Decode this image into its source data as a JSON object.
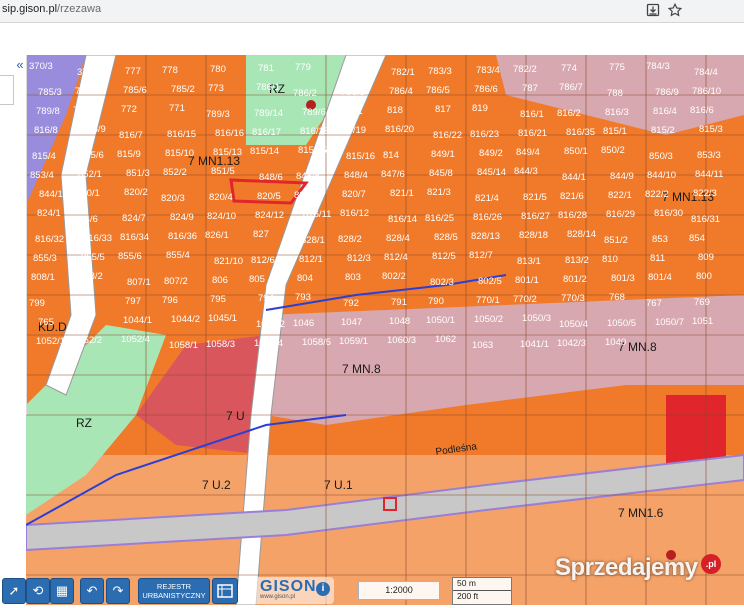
{
  "browser": {
    "url_host": "sip.gison.pl",
    "url_path": "/rzezawa",
    "icons": [
      "download-icon",
      "star-icon"
    ]
  },
  "side_panel": {
    "collapse_icon": "«"
  },
  "map": {
    "colors": {
      "residential_orange": "#f07a2a",
      "residential_light": "#f4a268",
      "mixed_pink": "#d8a8b0",
      "green_zone": "#a9e6b5",
      "purple_zone": "#9a8cdc",
      "red_zone": "#d9565c",
      "road_white": "#ffffff",
      "road_gray": "#c8c8c8",
      "parcel_line": "#8a4a2a",
      "plan_line_blue": "#2b3fd6"
    },
    "zone_labels": [
      "RZ",
      "7 MN1.13",
      "7 MN1.13",
      "7 MN.8",
      "7 MN.8",
      "7 U",
      "7 U.2",
      "7 U.1",
      "7 MN1.6",
      "RZ",
      "KD.D"
    ],
    "parcel_labels": [
      "370/3",
      "370/2",
      "777",
      "778",
      "780",
      "781",
      "779",
      "776",
      "782/1",
      "783/3",
      "783/4",
      "782/2",
      "774",
      "775",
      "784/3",
      "784/4",
      "785/3",
      "784/5",
      "785/6",
      "785/2",
      "773",
      "786/1",
      "786/2",
      "786/3",
      "786/4",
      "786/5",
      "786/6",
      "787",
      "786/7",
      "788",
      "786/9",
      "786/10",
      "789/8",
      "789/9",
      "772",
      "771",
      "789/3",
      "789/14",
      "789/6",
      "789/1",
      "818",
      "817",
      "819",
      "816/1",
      "816/2",
      "816/3",
      "816/4",
      "816/6",
      "816/8",
      "816/9",
      "816/7",
      "816/15",
      "816/16",
      "816/17",
      "816/18",
      "816/19",
      "816/20",
      "816/22",
      "816/23",
      "816/21",
      "816/35",
      "815/1",
      "815/2",
      "815/3",
      "815/4",
      "815/6",
      "815/9",
      "815/10",
      "815/13",
      "815/14",
      "815/15",
      "815/16",
      "814",
      "849/1",
      "849/2",
      "849/4",
      "850/1",
      "850/2",
      "850/3",
      "853/3",
      "853/4",
      "852/1",
      "851/3",
      "852/2",
      "851/5",
      "848/6",
      "848/8",
      "848/4",
      "847/6",
      "845/8",
      "845/14",
      "844/3",
      "844/1",
      "844/9",
      "844/10",
      "844/11",
      "844/12",
      "820/1",
      "820/2",
      "820/3",
      "820/4",
      "820/5",
      "820/6",
      "820/7",
      "821/1",
      "821/3",
      "821/4",
      "821/5",
      "821/6",
      "822/1",
      "822/2",
      "822/3",
      "824/1",
      "824/6",
      "824/7",
      "824/9",
      "824/10",
      "824/12",
      "816/11",
      "816/12",
      "816/14",
      "816/25",
      "816/26",
      "816/27",
      "816/28",
      "816/29",
      "816/30",
      "816/31",
      "816/32",
      "816/33",
      "816/34",
      "816/36",
      "826/1",
      "827",
      "828/1",
      "828/2",
      "828/4",
      "828/5",
      "828/13",
      "828/18",
      "828/14",
      "851/2",
      "853",
      "854",
      "855/3",
      "855/5",
      "855/6",
      "855/4",
      "821/10",
      "812/6",
      "812/1",
      "812/3",
      "812/4",
      "812/5",
      "812/7",
      "813/1",
      "813/2",
      "810",
      "811",
      "809",
      "808/1",
      "808/2",
      "807/1",
      "807/2",
      "806",
      "805",
      "804",
      "803",
      "802/2",
      "802/3",
      "802/5",
      "801/1",
      "801/2",
      "801/3",
      "801/4",
      "800",
      "799",
      "798",
      "797",
      "796",
      "795",
      "794",
      "793",
      "792",
      "791",
      "790",
      "770/1",
      "770/2",
      "770/3",
      "768",
      "767",
      "769",
      "765",
      "766",
      "1044/1",
      "1044/2",
      "1045/1",
      "1045/2",
      "1046",
      "1047",
      "1048",
      "1050/1",
      "1050/2",
      "1050/3",
      "1050/4",
      "1050/5",
      "1050/7",
      "1051",
      "1052/1",
      "1052/2",
      "1052/4",
      "1058/1",
      "1058/3",
      "1058/4",
      "1058/5",
      "1059/1",
      "1060/3",
      "1062",
      "1063",
      "1041/1",
      "1042/3",
      "1040"
    ],
    "street_label": "Podleśna"
  },
  "toolbar": {
    "tools": [
      "cursor-icon",
      "measure-icon",
      "map-icon",
      "undo-icon",
      "redo-icon"
    ],
    "register_line1": "REJESTR",
    "register_line2": "URBANISTYCZNY",
    "logo_text": "GISON",
    "logo_url": "www.gison.pl",
    "scale": "1:2000",
    "scale_metric": "50 m",
    "scale_imperial": "200 ft"
  },
  "watermark": {
    "text": "Sprzedajemy",
    "badge": ".pl"
  }
}
